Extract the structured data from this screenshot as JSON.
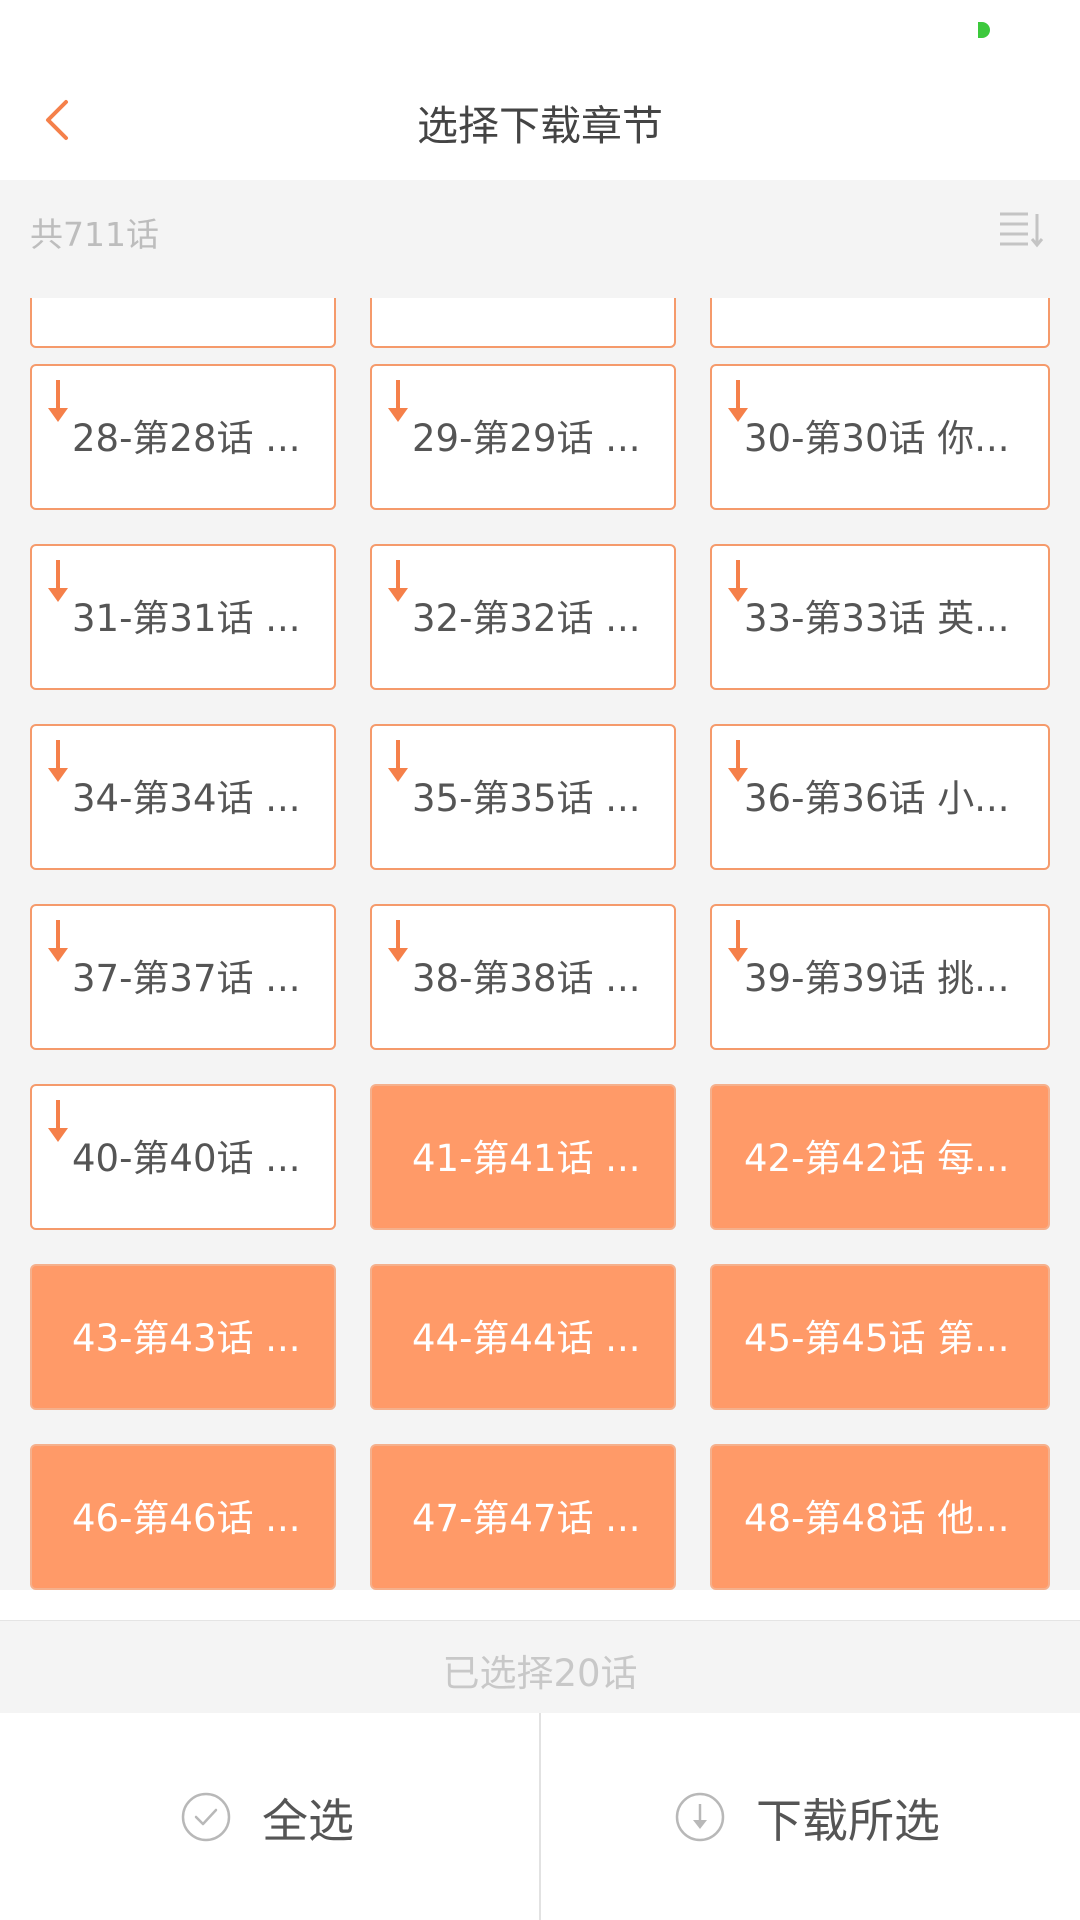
{
  "nav": {
    "title": "选择下载章节"
  },
  "summary": {
    "count_label": "共711话"
  },
  "chapters": [
    {
      "label": "",
      "selected": false,
      "partial": true
    },
    {
      "label": "",
      "selected": false,
      "partial": true
    },
    {
      "label": "",
      "selected": false,
      "partial": true
    },
    {
      "label": "28-第28话 ...",
      "selected": false
    },
    {
      "label": "29-第29话 ...",
      "selected": false
    },
    {
      "label": "30-第30话 你...",
      "selected": false
    },
    {
      "label": "31-第31话 ...",
      "selected": false
    },
    {
      "label": "32-第32话 ...",
      "selected": false
    },
    {
      "label": "33-第33话 英...",
      "selected": false
    },
    {
      "label": "34-第34话 ...",
      "selected": false
    },
    {
      "label": "35-第35话 ...",
      "selected": false
    },
    {
      "label": "36-第36话 小...",
      "selected": false
    },
    {
      "label": "37-第37话 ...",
      "selected": false
    },
    {
      "label": "38-第38话 ...",
      "selected": false
    },
    {
      "label": "39-第39话 挑...",
      "selected": false
    },
    {
      "label": "40-第40话 ...",
      "selected": false
    },
    {
      "label": "41-第41话 ...",
      "selected": true
    },
    {
      "label": "42-第42话 每...",
      "selected": true
    },
    {
      "label": "43-第43话 ...",
      "selected": true
    },
    {
      "label": "44-第44话 ...",
      "selected": true
    },
    {
      "label": "45-第45话 第...",
      "selected": true
    },
    {
      "label": "46-第46话 ...",
      "selected": true
    },
    {
      "label": "47-第47话 ...",
      "selected": true
    },
    {
      "label": "48-第48话 他...",
      "selected": true
    }
  ],
  "selection": {
    "summary": "已选择20话"
  },
  "actions": {
    "select_all_label": "全选",
    "download_selected_label": "下载所选"
  },
  "colors": {
    "accent": "#ff9a68",
    "tile_border": "#f59a6b",
    "arrow": "#f5804a",
    "status_dot": "#3cc93c"
  },
  "icons": {
    "back": "back-chevron-icon",
    "sort": "sort-list-icon",
    "download_arrow": "download-arrow-icon",
    "select_all": "check-circle-icon",
    "download": "download-circle-icon"
  }
}
